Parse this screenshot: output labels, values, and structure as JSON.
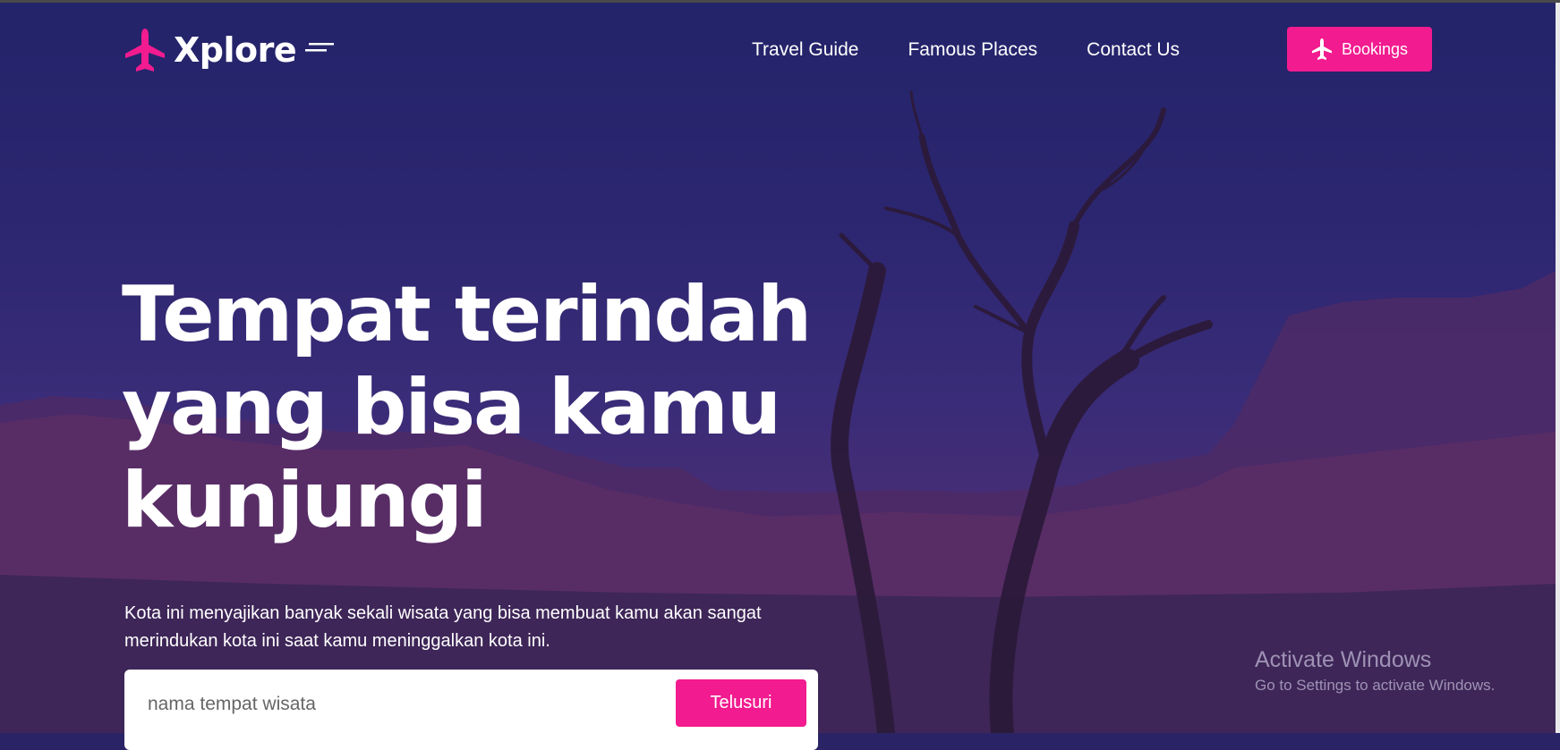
{
  "brand": {
    "name": "Xplore",
    "accent": "#f21b8f"
  },
  "nav": {
    "items": [
      "Travel Guide",
      "Famous Places",
      "Contact Us"
    ]
  },
  "bookings": {
    "label": "Bookings",
    "icon": "plane-icon"
  },
  "hero": {
    "title": "Tempat terindah yang bisa kamu kunjungi",
    "description": "Kota ini menyajikan banyak sekali wisata yang bisa membuat kamu akan sangat merindukan kota ini saat kamu meninggalkan kota ini."
  },
  "search": {
    "placeholder": "nama tempat wisata",
    "button": "Telusuri"
  },
  "watermark": {
    "title": "Activate Windows",
    "subtitle": "Go to Settings to activate Windows."
  }
}
